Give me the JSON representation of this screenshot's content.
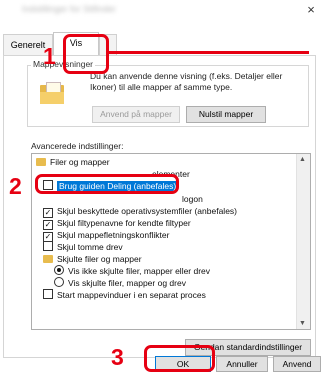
{
  "window": {
    "title": "Indstillinger for Stifinder",
    "close_glyph": "×"
  },
  "tabs": [
    "Generelt",
    "Vis",
    "Søg"
  ],
  "folder_views": {
    "legend": "Mappevisninger",
    "description": "Du kan anvende denne visning (f.eks. Detaljer eller Ikoner) til alle mapper af samme type.",
    "apply_button": "Anvend på mapper",
    "reset_button": "Nulstil mapper"
  },
  "advanced": {
    "label": "Avancerede indstillinger:",
    "items": [
      {
        "kind": "folder",
        "label": "Filer og mapper"
      },
      {
        "kind": "checkbox",
        "checked": true,
        "label": "elementer"
      },
      {
        "kind": "checkbox",
        "checked": false,
        "label": "Brug guiden Deling (anbefales)",
        "selected": true
      },
      {
        "kind": "checkbox",
        "checked": true,
        "label": "logon"
      },
      {
        "kind": "checkbox",
        "checked": true,
        "label": "Skjul beskyttede operativsystemfiler (anbefales)"
      },
      {
        "kind": "checkbox",
        "checked": true,
        "label": "Skjul filtypenavne for kendte filtyper"
      },
      {
        "kind": "checkbox",
        "checked": true,
        "label": "Skjul mappefletningskonflikter"
      },
      {
        "kind": "checkbox",
        "checked": false,
        "label": "Skjul tomme drev"
      },
      {
        "kind": "folder",
        "label": "Skjulte filer og mapper"
      },
      {
        "kind": "radio",
        "checked": true,
        "label": "Vis ikke skjulte filer, mapper eller drev"
      },
      {
        "kind": "radio",
        "checked": false,
        "label": "Vis skjulte filer, mapper og drev"
      },
      {
        "kind": "checkbox",
        "checked": false,
        "label": "Start mappevinduer i en separat proces"
      }
    ]
  },
  "buttons": {
    "restore_defaults": "Gendan standardindstillinger",
    "ok": "OK",
    "cancel": "Annuller",
    "apply": "Anvend"
  },
  "callouts": [
    "1",
    "2",
    "3"
  ],
  "colors": {
    "callout": "#e60012",
    "selection": "#0078d7"
  }
}
